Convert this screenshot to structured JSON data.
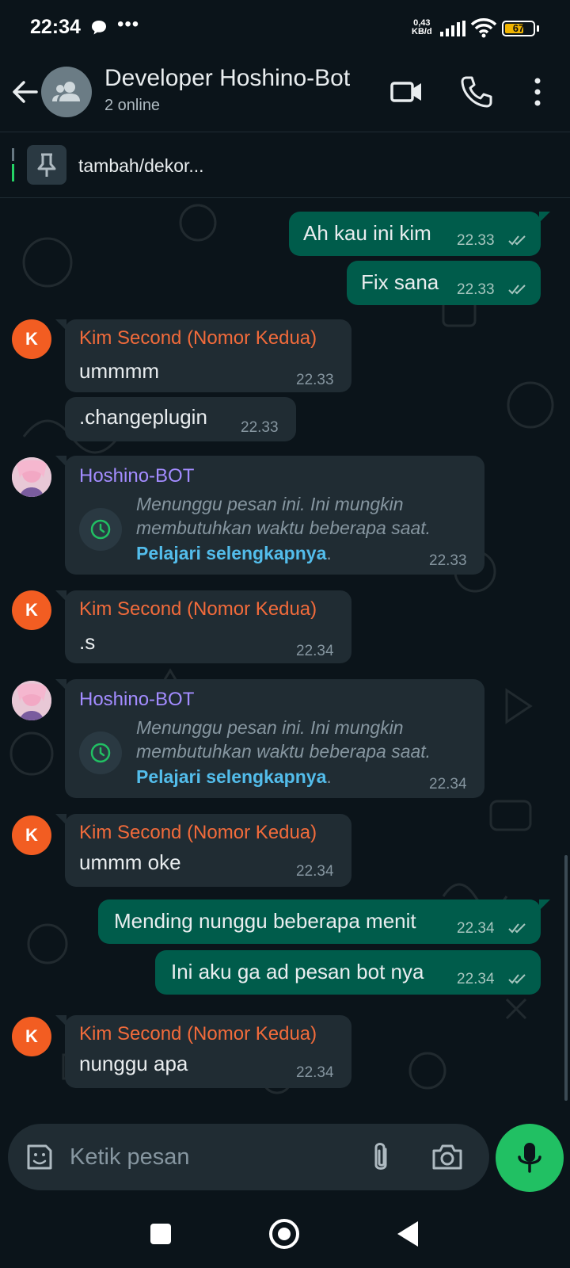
{
  "status_bar": {
    "time": "22:34",
    "net_speed_value": "0,43",
    "net_speed_unit": "KB/d",
    "battery": "67",
    "battery_level": 0.67
  },
  "header": {
    "title": "Developer Hoshino-Bot",
    "subtitle": "2 online"
  },
  "pinned": {
    "text": "tambah/dekor..."
  },
  "messages": [
    {
      "type": "out",
      "text": "Ah kau ini kim",
      "time": "22.33"
    },
    {
      "type": "out",
      "text": "Fix sana",
      "time": "22.33"
    },
    {
      "type": "in",
      "sender": "Kim Second (Nomor Kedua)",
      "avatar": "K",
      "text": "ummmm",
      "time": "22.33"
    },
    {
      "type": "in",
      "text": ".changeplugin",
      "time": "22.33"
    },
    {
      "type": "waiting",
      "sender": "Hoshino-BOT",
      "line1": "Menunggu pesan ini. Ini mungkin",
      "line2": "membutuhkan waktu beberapa saat.",
      "link": "Pelajari selengkapnya",
      "link_suffix": ".",
      "time": "22.33"
    },
    {
      "type": "in",
      "sender": "Kim Second (Nomor Kedua)",
      "avatar": "K",
      "text": ".s",
      "time": "22.34"
    },
    {
      "type": "waiting",
      "sender": "Hoshino-BOT",
      "line1": "Menunggu pesan ini. Ini mungkin",
      "line2": "membutuhkan waktu beberapa saat.",
      "link": "Pelajari selengkapnya",
      "link_suffix": ".",
      "time": "22.34"
    },
    {
      "type": "in",
      "sender": "Kim Second (Nomor Kedua)",
      "avatar": "K",
      "text": "ummm oke",
      "time": "22.34"
    },
    {
      "type": "out",
      "text": "Mending nunggu beberapa menit",
      "time": "22.34"
    },
    {
      "type": "out",
      "text": "Ini aku ga ad pesan bot nya",
      "time": "22.34"
    },
    {
      "type": "in",
      "sender": "Kim Second (Nomor Kedua)",
      "avatar": "K",
      "text": "nunggu apa",
      "time": "22.34"
    }
  ],
  "input": {
    "placeholder": "Ketik pesan"
  },
  "colors": {
    "background": "#0b141a",
    "outgoing_bubble": "#005c4b",
    "incoming_bubble": "#202c33",
    "kim_name": "#f26b3b",
    "bot_name": "#a38cff",
    "link": "#53bdeb",
    "mic_button": "#21c063"
  },
  "icons": [
    "back-arrow-icon",
    "group-icon",
    "video-call-icon",
    "phone-icon",
    "more-vert-icon",
    "pin-icon",
    "clock-icon",
    "double-check-icon",
    "sticker-icon",
    "attach-icon",
    "camera-icon",
    "mic-icon"
  ]
}
